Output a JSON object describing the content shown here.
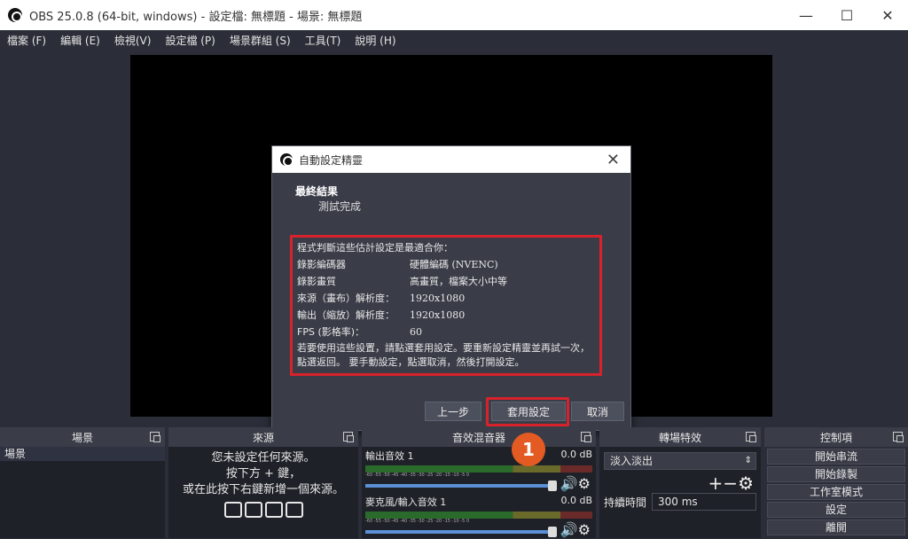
{
  "window": {
    "title": "OBS 25.0.8 (64-bit, windows) - 設定檔: 無標題 - 場景: 無標題",
    "minimize": "—",
    "maximize": "☐",
    "close": "✕"
  },
  "menu": [
    "檔案 (F)",
    "編輯 (E)",
    "檢視(V)",
    "設定檔 (P)",
    "場景群組 (S)",
    "工具(T)",
    "說明 (H)"
  ],
  "dialog": {
    "title": "自動設定精靈",
    "close": "✕",
    "heading": "最終結果",
    "subheading": "測試完成",
    "intro": "程式判斷這些估計設定是最適合你：",
    "rows": [
      {
        "key": "錄影編碼器",
        "value": "硬體編碼 (NVENC)"
      },
      {
        "key": "錄影畫質",
        "value": "高畫質，檔案大小中等"
      },
      {
        "key": "來源（畫布）解析度：",
        "value": "1920x1080"
      },
      {
        "key": "輸出（縮放）解析度：",
        "value": "1920x1080"
      },
      {
        "key": "FPS (影格率)：",
        "value": "60"
      }
    ],
    "note": "若要使用這些設置，請點選套用設定。要重新設定精靈並再試一次，點選返回。 要手動設定，點選取消，然後打開設定。",
    "buttons": {
      "prev": "上一步",
      "apply": "套用設定",
      "cancel": "取消"
    }
  },
  "annotation_badge": "1",
  "docks": {
    "scenes": {
      "title": "場景",
      "item": "場景"
    },
    "sources": {
      "title": "來源",
      "empty_text": "您未設定任何來源。\n按下方 + 鍵，\n或在此按下右鍵新增一個來源。"
    },
    "mixer": {
      "title": "音效混音器",
      "channels": [
        {
          "name": "輸出音效 1",
          "db": "0.0 dB",
          "level": 0.0
        },
        {
          "name": "麥克風/輸入音效 1",
          "db": "0.0 dB",
          "level": 0.2
        }
      ],
      "ticks": "-60 -55 -50 -45 -40 -35 -30 -25 -20 -15 -10 -5 0"
    },
    "transitions": {
      "title": "轉場特效",
      "selected": "淡入淡出",
      "duration_label": "持續時間",
      "duration_value": "300 ms"
    },
    "controls": {
      "title": "控制項",
      "buttons": [
        "開始串流",
        "開始錄製",
        "工作室模式",
        "設定",
        "離開"
      ]
    }
  }
}
